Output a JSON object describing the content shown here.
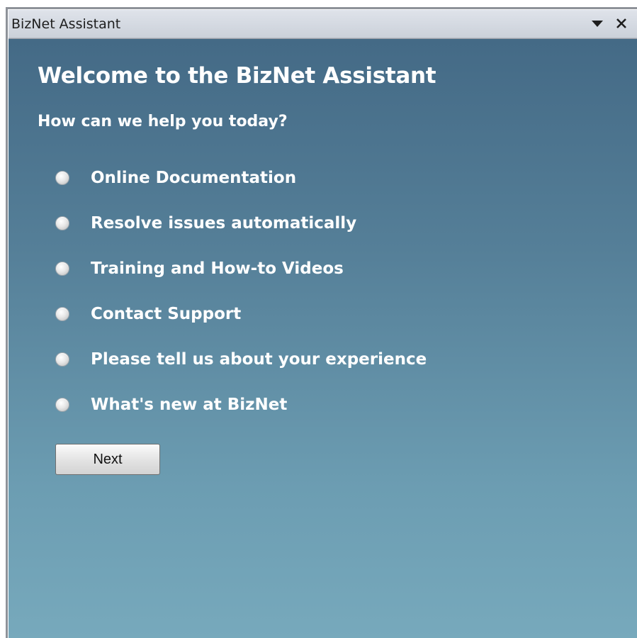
{
  "window": {
    "title": "BizNet Assistant",
    "dropdown_icon": "triangle-down",
    "close_icon": "x-close"
  },
  "main": {
    "heading": "Welcome to the BizNet Assistant",
    "question": "How can we help you today?",
    "options": [
      {
        "label": "Online Documentation",
        "selected": false
      },
      {
        "label": "Resolve issues automatically",
        "selected": false
      },
      {
        "label": "Training and How-to Videos",
        "selected": false
      },
      {
        "label": "Contact Support",
        "selected": false
      },
      {
        "label": "Please tell us about your experience",
        "selected": false
      },
      {
        "label": "What's new at BizNet",
        "selected": false
      }
    ],
    "next_label": "Next"
  },
  "colors": {
    "panel_top": "#446a86",
    "panel_bottom": "#77a9bc",
    "text": "#ffffff"
  }
}
